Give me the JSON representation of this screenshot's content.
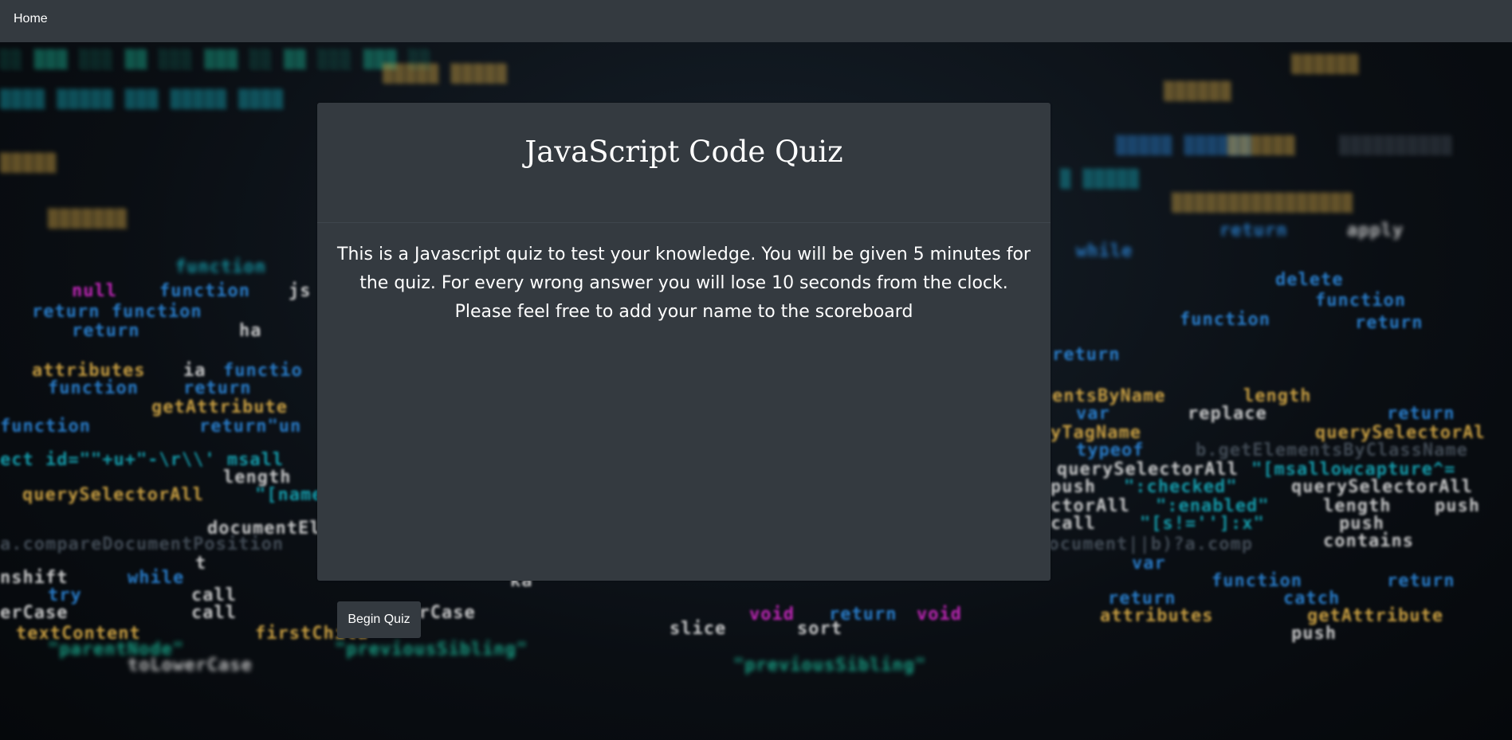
{
  "nav": {
    "home_label": "Home"
  },
  "quiz": {
    "title": "JavaScript Code Quiz",
    "description": "This is a Javascript quiz to test your knowledge. You will be given 5 minutes for the quiz. For every wrong answer you will lose 10 seconds from the clock. Please feel free to add your name to the scoreboard",
    "begin_label": "Begin Quiz"
  },
  "background": {
    "image": "blurred-javascript-code-image"
  },
  "colors": {
    "navbar": "#343a40",
    "card": "#343a40",
    "text": "#ffffff"
  }
}
